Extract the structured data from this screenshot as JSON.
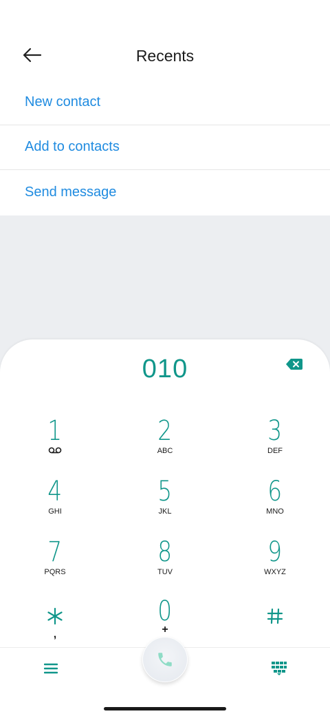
{
  "header": {
    "title": "Recents",
    "back_icon": "arrow-left-icon"
  },
  "actions": [
    {
      "label": "New contact"
    },
    {
      "label": "Add to contacts"
    },
    {
      "label": "Send message"
    }
  ],
  "dialer": {
    "number": "010",
    "backspace_icon": "backspace-icon",
    "keys": [
      {
        "digit": "1",
        "letters": "",
        "sub_icon": "voicemail-icon"
      },
      {
        "digit": "2",
        "letters": "ABC"
      },
      {
        "digit": "3",
        "letters": "DEF"
      },
      {
        "digit": "4",
        "letters": "GHI"
      },
      {
        "digit": "5",
        "letters": "JKL"
      },
      {
        "digit": "6",
        "letters": "MNO"
      },
      {
        "digit": "7",
        "letters": "PQRS"
      },
      {
        "digit": "8",
        "letters": "TUV"
      },
      {
        "digit": "9",
        "letters": "WXYZ"
      },
      {
        "digit": "*",
        "letters": ",",
        "icon": "asterisk-icon"
      },
      {
        "digit": "0",
        "letters": "+"
      },
      {
        "digit": "#",
        "letters": "",
        "icon": "hash-icon"
      }
    ]
  },
  "bottom": {
    "menu_icon": "menu-icon",
    "call_icon": "phone-icon",
    "dialpad_icon": "dialpad-icon"
  },
  "colors": {
    "accent": "#10968a",
    "link": "#1f8be0",
    "background": "#eceef1",
    "call_icon": "#8fdcc6"
  }
}
